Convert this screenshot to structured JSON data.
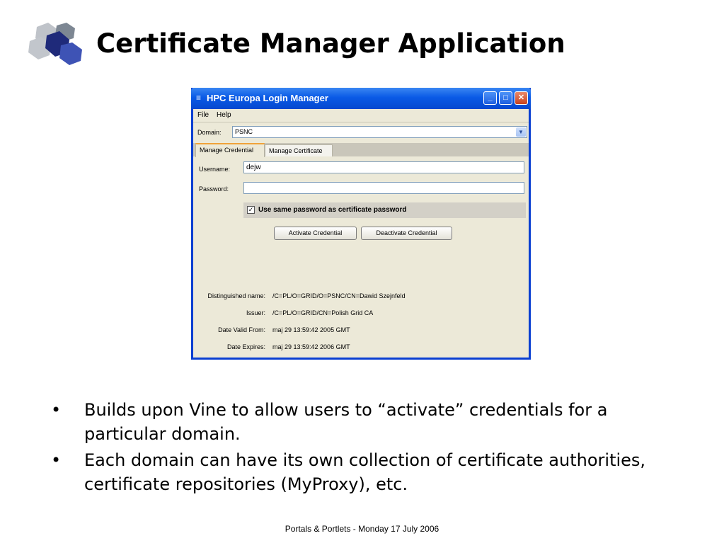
{
  "slide": {
    "title": "Certificate Manager Application",
    "bullets": [
      "Builds upon Vine to allow users to “activate” credentials for a particular domain.",
      "Each domain can have its own collection of certificate authorities, certificate repositories (MyProxy), etc."
    ],
    "bullet_symbol": "•",
    "footer": "Portals & Portlets - Monday 17 July 2006"
  },
  "window": {
    "title": "HPC Europa Login Manager",
    "app_icon": "≡",
    "minimize_glyph": "_",
    "maximize_glyph": "□",
    "close_glyph": "✕",
    "menu": [
      "File",
      "Help"
    ],
    "domain": {
      "label": "Domain:",
      "value": "PSNC",
      "arrow": "▼"
    },
    "tabs": [
      "Manage Credential",
      "Manage Certificate"
    ],
    "active_tab": "Manage Credential",
    "username": {
      "label": "Username:",
      "value": "dejw"
    },
    "password": {
      "label": "Password:",
      "value": ""
    },
    "same_password": {
      "checked": true,
      "check_glyph": "✓",
      "label": "Use same password as certificate password"
    },
    "buttons": {
      "activate": "Activate Credential",
      "deactivate": "Deactivate Credential"
    },
    "info": [
      {
        "label": "Distinguished name:",
        "value": "/C=PL/O=GRID/O=PSNC/CN=Dawid Szejnfeld"
      },
      {
        "label": "Issuer:",
        "value": "/C=PL/O=GRID/CN=Polish Grid CA"
      },
      {
        "label": "Date Valid From:",
        "value": "maj 29 13:59:42 2005 GMT"
      },
      {
        "label": "Date Expires:",
        "value": "maj 29 13:59:42 2006 GMT"
      }
    ]
  },
  "colors": {
    "titlebar": "#0a5ae6",
    "window_bg": "#ece9d8",
    "tab_accent": "#f0a33a"
  }
}
